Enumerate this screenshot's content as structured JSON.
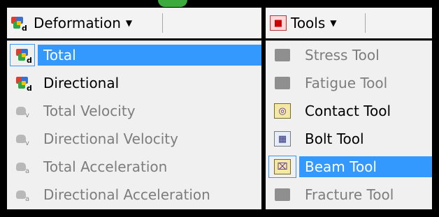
{
  "left_toolbar": {
    "button_label": "Deformation",
    "icon": "deformation-cube-icon"
  },
  "right_toolbar": {
    "button_label": "Tools",
    "icon": "tools-icon"
  },
  "deformation_menu": {
    "items": [
      {
        "label": "Total",
        "subscript": "d",
        "state": "selected"
      },
      {
        "label": "Directional",
        "subscript": "d",
        "state": "enabled"
      },
      {
        "label": "Total Velocity",
        "subscript": "v",
        "state": "disabled"
      },
      {
        "label": "Directional Velocity",
        "subscript": "v",
        "state": "disabled"
      },
      {
        "label": "Total Acceleration",
        "subscript": "a",
        "state": "disabled"
      },
      {
        "label": "Directional Acceleration",
        "subscript": "a",
        "state": "disabled"
      }
    ]
  },
  "tools_menu": {
    "items": [
      {
        "label": "Stress Tool",
        "state": "disabled"
      },
      {
        "label": "Fatigue Tool",
        "state": "disabled"
      },
      {
        "label": "Contact Tool",
        "state": "enabled"
      },
      {
        "label": "Bolt Tool",
        "state": "enabled"
      },
      {
        "label": "Beam Tool",
        "state": "selected"
      },
      {
        "label": "Fracture Tool",
        "state": "disabled"
      }
    ]
  },
  "colors": {
    "selection": "#3399ff",
    "menu_bg": "#f0f0f0",
    "disabled_text": "#7d7d7d"
  }
}
